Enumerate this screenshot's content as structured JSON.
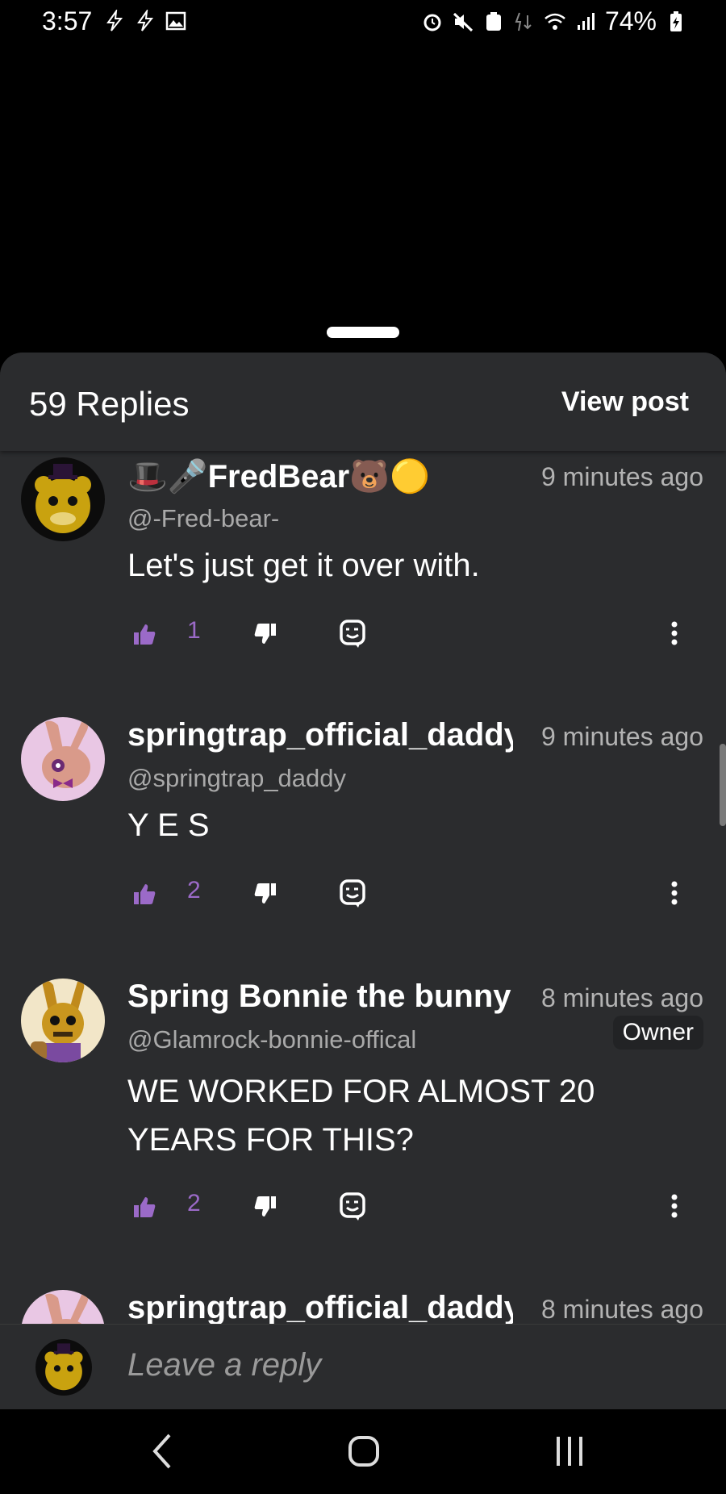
{
  "status_bar": {
    "time": "3:57",
    "battery": "74%"
  },
  "sheet": {
    "replies_count": "59 Replies",
    "view_post_label": "View post"
  },
  "comments": [
    {
      "name": "FredBear",
      "name_prefix_emoji": "🎩🎤",
      "name_suffix_emoji": "🐻🟡",
      "time": "9 minutes ago",
      "handle": "@-Fred-bear-",
      "body": "Let's just get it over with.",
      "likes": "1",
      "avatar_icon": "golden-freddy-avatar"
    },
    {
      "name": "springtrap_official_daddy",
      "time": "9 minutes ago",
      "handle": "@springtrap_daddy",
      "body": "Y E S",
      "likes": "2",
      "avatar_icon": "pink-bunny-avatar"
    },
    {
      "name": "Spring Bonnie the bunny",
      "time": "8 minutes ago",
      "handle": "@Glamrock-bonnie-offical",
      "badge": "Owner",
      "body_line1": "WE WORKED FOR ALMOST 20",
      "body_line2": "YEARS FOR THIS?",
      "likes": "2",
      "avatar_icon": "spring-bonnie-avatar"
    },
    {
      "name": "springtrap_official_daddy",
      "time": "8 minutes ago",
      "avatar_icon": "pink-bunny-avatar"
    }
  ],
  "reply_bar": {
    "placeholder": "Leave a reply"
  },
  "colors": {
    "sheet_bg": "#2b2c2e",
    "like_accent": "#9b6ac8",
    "muted_text": "#a9a9a9"
  }
}
